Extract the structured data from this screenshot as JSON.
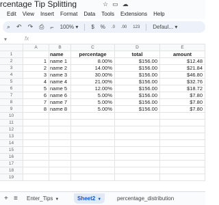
{
  "doc": {
    "title": "rcentage Tip Splitting"
  },
  "menu": {
    "items": [
      "Edit",
      "View",
      "Insert",
      "Format",
      "Data",
      "Tools",
      "Extensions",
      "Help"
    ]
  },
  "toolbar": {
    "zoom": "100%",
    "currency": "$",
    "percent": "%",
    "dec_decrease": ".0",
    "dec_increase": ".00",
    "number_format": "123",
    "font": "Defaul..."
  },
  "formula": {
    "fx": "fx"
  },
  "grid": {
    "columns": [
      "A",
      "B",
      "C",
      "D",
      "E"
    ],
    "headers": [
      "",
      "name",
      "percentage",
      "total",
      "amount"
    ],
    "rows": [
      {
        "num": "1",
        "a": "",
        "b": "",
        "c": "",
        "d": "",
        "e": ""
      },
      {
        "num": "2",
        "a": "1",
        "b": "name 1",
        "c": "8.00%",
        "d": "$156.00",
        "e": "$12.48"
      },
      {
        "num": "3",
        "a": "2",
        "b": "name 2",
        "c": "14.00%",
        "d": "$156.00",
        "e": "$21.84"
      },
      {
        "num": "4",
        "a": "3",
        "b": "name 3",
        "c": "30.00%",
        "d": "$156.00",
        "e": "$46.80"
      },
      {
        "num": "5",
        "a": "4",
        "b": "name 4",
        "c": "21.00%",
        "d": "$156.00",
        "e": "$32.76"
      },
      {
        "num": "6",
        "a": "5",
        "b": "name 5",
        "c": "12.00%",
        "d": "$156.00",
        "e": "$18.72"
      },
      {
        "num": "7",
        "a": "6",
        "b": "name 6",
        "c": "5.00%",
        "d": "$156.00",
        "e": "$7.80"
      },
      {
        "num": "8",
        "a": "7",
        "b": "name 7",
        "c": "5.00%",
        "d": "$156.00",
        "e": "$7.80"
      },
      {
        "num": "9",
        "a": "8",
        "b": "name 8",
        "c": "5.00%",
        "d": "$156.00",
        "e": "$7.80"
      },
      {
        "num": "10",
        "a": "",
        "b": "",
        "c": "",
        "d": "",
        "e": ""
      },
      {
        "num": "11",
        "a": "",
        "b": "",
        "c": "",
        "d": "",
        "e": ""
      },
      {
        "num": "12",
        "a": "",
        "b": "",
        "c": "",
        "d": "",
        "e": ""
      },
      {
        "num": "13",
        "a": "",
        "b": "",
        "c": "",
        "d": "",
        "e": ""
      },
      {
        "num": "14",
        "a": "",
        "b": "",
        "c": "",
        "d": "",
        "e": ""
      },
      {
        "num": "15",
        "a": "",
        "b": "",
        "c": "",
        "d": "",
        "e": ""
      },
      {
        "num": "16",
        "a": "",
        "b": "",
        "c": "",
        "d": "",
        "e": ""
      },
      {
        "num": "17",
        "a": "",
        "b": "",
        "c": "",
        "d": "",
        "e": ""
      },
      {
        "num": "18",
        "a": "",
        "b": "",
        "c": "",
        "d": "",
        "e": ""
      },
      {
        "num": "19",
        "a": "",
        "b": "",
        "c": "",
        "d": "",
        "e": ""
      }
    ]
  },
  "sheets": {
    "tabs": [
      {
        "label": "Enter_Tips",
        "active": false
      },
      {
        "label": "Sheet2",
        "active": true
      },
      {
        "label": "percentage_distribution",
        "active": false
      }
    ]
  },
  "colors": {
    "active_tab_text": "#0b57d0",
    "active_tab_bg": "#e1e9f7",
    "toolbar_bg": "#edf2fa"
  },
  "icons": {
    "title": [
      "star-icon",
      "move-to-folder-icon",
      "cloud-status-icon"
    ],
    "toolbar": [
      "search-icon",
      "undo-icon",
      "redo-icon",
      "print-icon",
      "paint-format-icon"
    ],
    "bottom": [
      "add-sheet-icon",
      "all-sheets-icon"
    ]
  }
}
